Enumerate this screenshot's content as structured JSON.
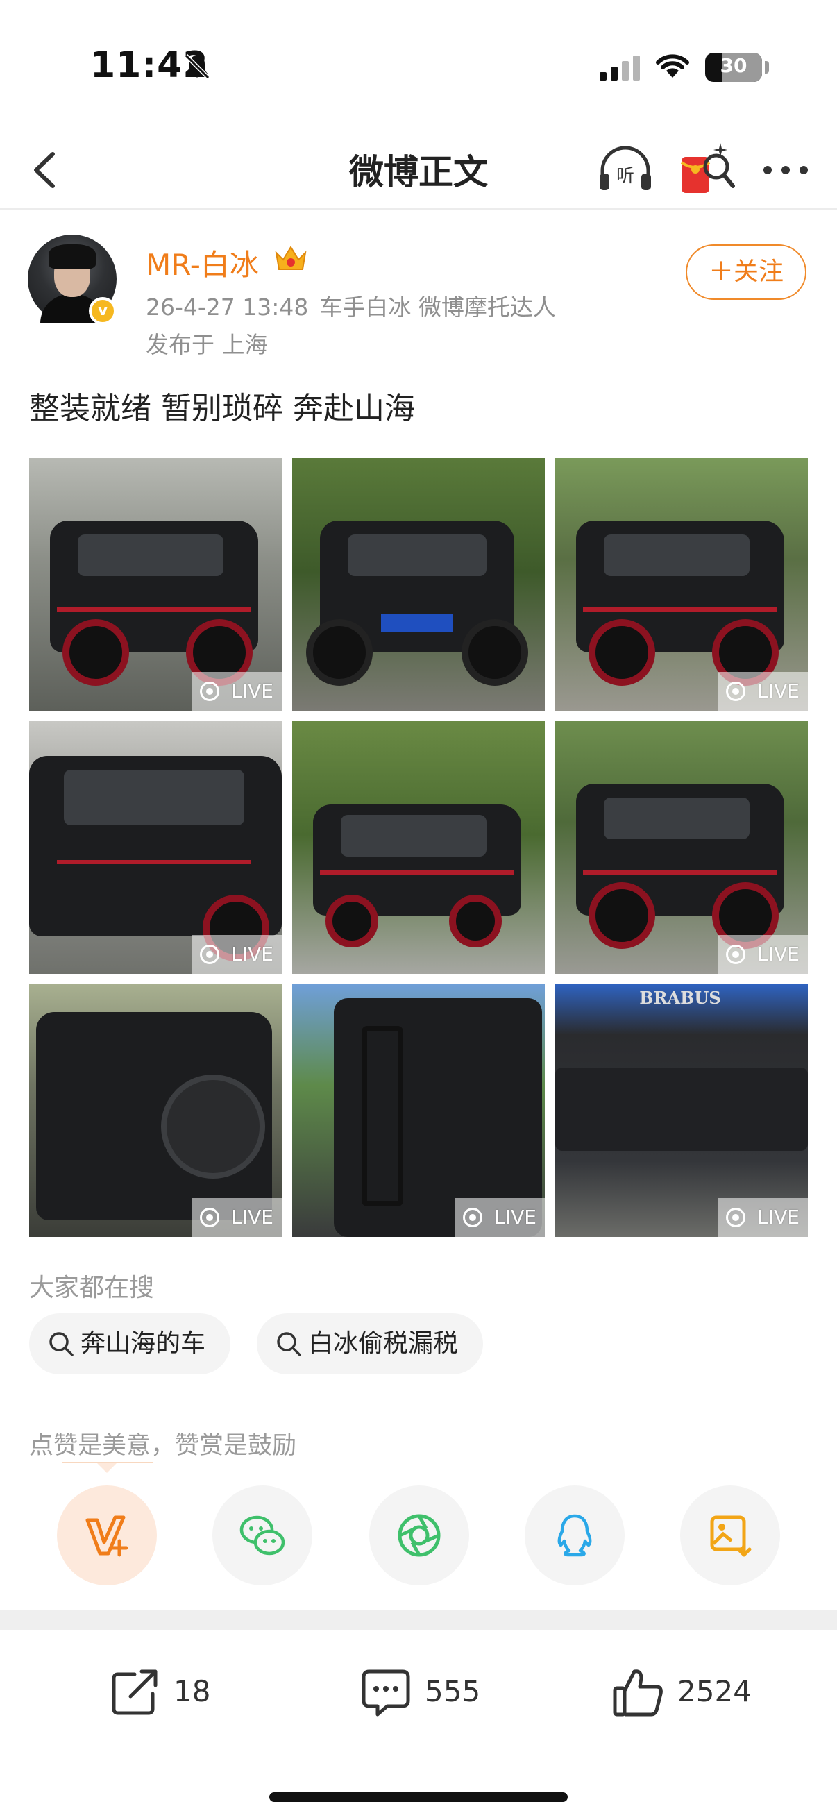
{
  "status_bar": {
    "time": "11:42",
    "battery": "30",
    "icons": [
      "bell-off-icon",
      "signal-icon",
      "wifi-icon",
      "battery-icon"
    ]
  },
  "nav": {
    "title": "微博正文",
    "icons": [
      "back-icon",
      "headphones-listen-icon",
      "red-packet-icon",
      "more-icon"
    ]
  },
  "post": {
    "username": "MR-白冰",
    "meta": {
      "time": "26-4-27 13:48",
      "source": "车手白冰 微博摩托达人"
    },
    "location": "发布于 上海",
    "follow_label": "＋关注",
    "text": "整装就绪 暂别琐碎 奔赴山海",
    "photos": [
      {
        "live": "LIVE"
      },
      {
        "live": ""
      },
      {
        "live": "LIVE"
      },
      {
        "live": "LIVE"
      },
      {
        "live": ""
      },
      {
        "live": "LIVE"
      },
      {
        "live": "LIVE"
      },
      {
        "live": "LIVE"
      },
      {
        "live": "LIVE"
      }
    ]
  },
  "hot_search": {
    "title": "大家都在搜",
    "chips": [
      "奔山海的车",
      "白冰偷税漏税"
    ]
  },
  "praise": {
    "text": "点赞是美意，赞赏是鼓励",
    "share_icons": [
      "praise-icon",
      "wechat-icon",
      "moments-icon",
      "qq-icon",
      "save-image-icon"
    ]
  },
  "actions": {
    "repost": "18",
    "comment": "555",
    "like": "2524"
  },
  "colors": {
    "accent": "#f07d1a",
    "muted": "#8f8f8f",
    "wechat": "#3fc06b",
    "qq": "#2aa8e8",
    "save": "#f2a516"
  }
}
